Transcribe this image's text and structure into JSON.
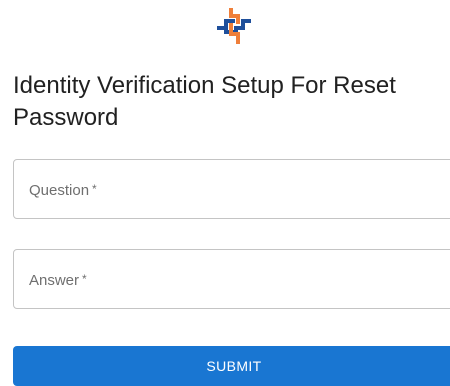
{
  "logo": {
    "icon": "chain-link-logo-icon",
    "colors": {
      "orange": "#ef7f3a",
      "blue": "#1e4f9b"
    }
  },
  "header": {
    "title": "Identity Verification Setup For Reset Password"
  },
  "form": {
    "question": {
      "label": "Question",
      "required_marker": "*",
      "value": ""
    },
    "answer": {
      "label": "Answer",
      "required_marker": "*",
      "value": ""
    },
    "submit_label": "SUBMIT"
  },
  "colors": {
    "accent": "#1976d2",
    "border": "#c4c4c4",
    "label": "#6f6f6f"
  }
}
